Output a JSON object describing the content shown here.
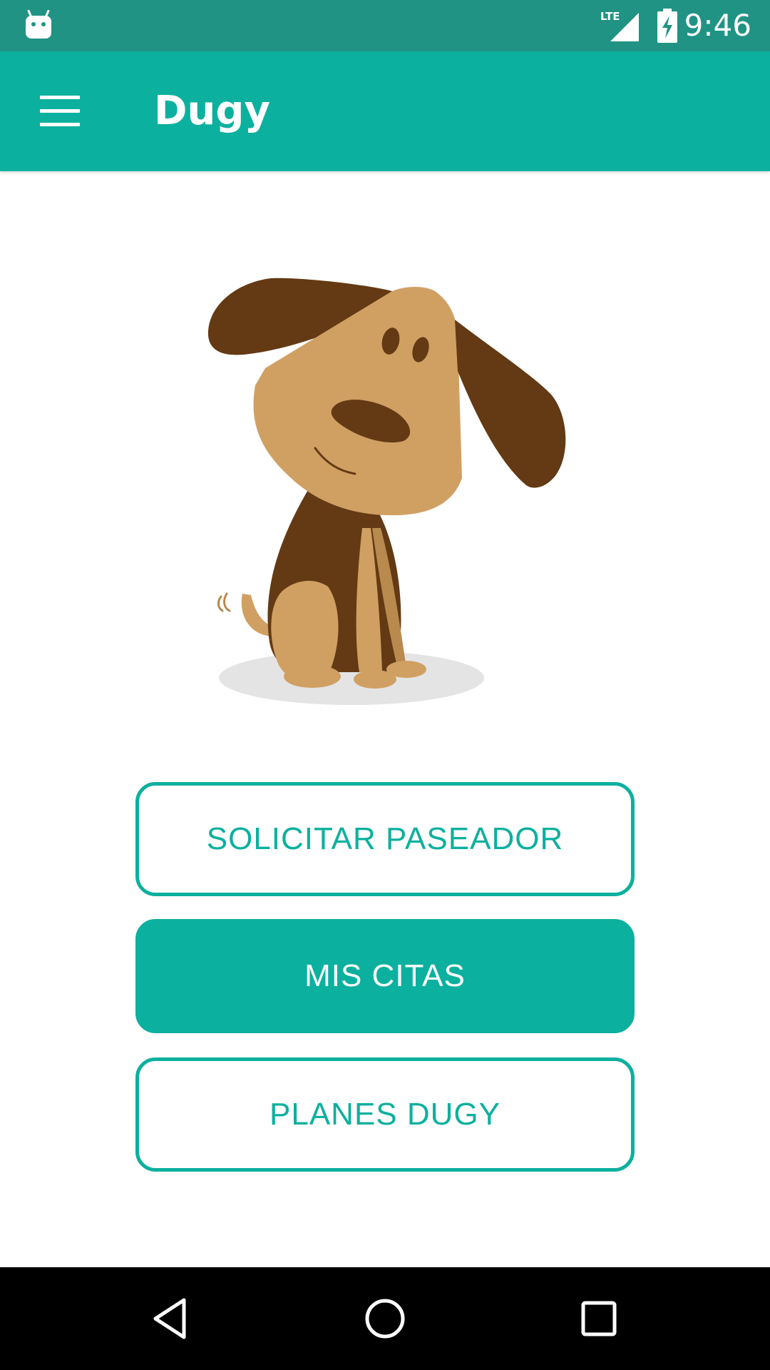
{
  "status_bar": {
    "time": "9:46",
    "network_label": "LTE",
    "icons": [
      "android-notification-icon",
      "lte-signal-icon",
      "battery-charging-icon"
    ]
  },
  "app_bar": {
    "title": "Dugy",
    "menu_icon": "hamburger-menu-icon"
  },
  "illustration": {
    "subject": "dog-illustration-icon"
  },
  "actions": {
    "request_walker": "SOLICITAR PASEADOR",
    "my_appointments": "MIS CITAS",
    "dugy_plans": "PLANES DUGY"
  },
  "nav_bar": {
    "icons": [
      "back-icon",
      "home-icon",
      "recents-icon"
    ]
  },
  "colors": {
    "status_bar": "#209384",
    "primary": "#0cb09e",
    "dog_dark": "#633a14",
    "dog_light": "#d0a063",
    "shadow": "#e4e4e4",
    "nav_bar": "#000000"
  }
}
